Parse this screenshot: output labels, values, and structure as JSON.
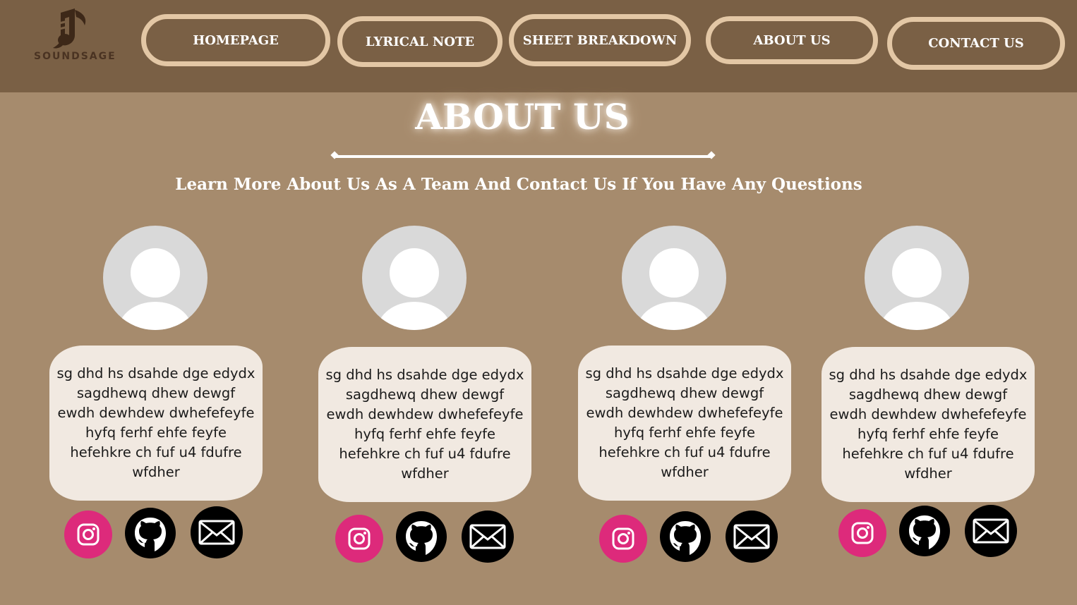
{
  "brand": {
    "name": "SOUNDSAGE"
  },
  "nav": {
    "items": [
      {
        "label": "HOMEPAGE"
      },
      {
        "label": "LYRICAL NOTE"
      },
      {
        "label": "SHEET BREAKDOWN"
      },
      {
        "label": "ABOUT US"
      },
      {
        "label": "CONTACT US"
      }
    ]
  },
  "page": {
    "title": "ABOUT US",
    "subtitle": "Learn More About Us As A Team And Contact Us If You Have Any Questions"
  },
  "members": [
    {
      "bio": "sg dhd hs dsahde dge edydx sagdhewq dhew dewgf ewdh dewhdew dwhefefeyfe hyfq ferhf ehfe feyfe hefehkre ch fuf u4 fdufre wfdher"
    },
    {
      "bio": "sg dhd hs dsahde dge edydx sagdhewq dhew dewgf ewdh dewhdew dwhefefeyfe hyfq ferhf ehfe feyfe hefehkre ch fuf u4 fdufre wfdher"
    },
    {
      "bio": "sg dhd hs dsahde dge edydx sagdhewq dhew dewgf ewdh dewhdew dwhefefeyfe hyfq ferhf ehfe feyfe hefehkre ch fuf u4 fdufre wfdher"
    },
    {
      "bio": "sg dhd hs dsahde dge edydx sagdhewq dhew dewgf ewdh dewhdew dwhefefeyfe hyfq ferhf ehfe feyfe hefehkre ch fuf u4 fdufre wfdher"
    }
  ],
  "social_icons": [
    "instagram-icon",
    "github-icon",
    "mail-icon"
  ],
  "colors": {
    "header": "#7a6045",
    "background": "#a68b6d",
    "nav_border": "#e3c7a5",
    "card": "#f1e9e1",
    "instagram": "#dd2a7b"
  }
}
